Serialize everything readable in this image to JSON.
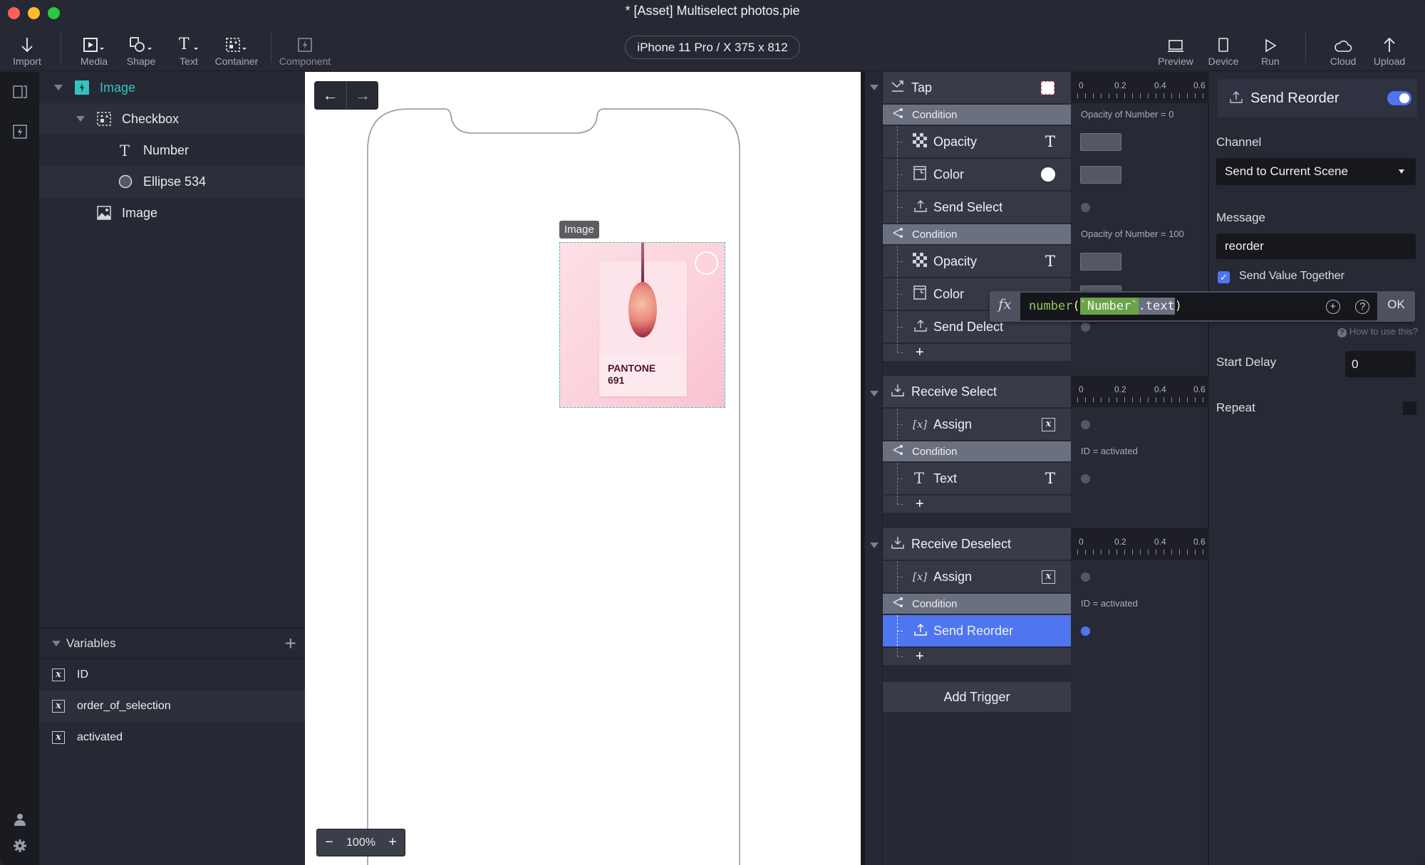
{
  "window": {
    "title": "* [Asset] Multiselect photos.pie"
  },
  "toolbar": {
    "left_tools": [
      {
        "id": "import",
        "label": "Import",
        "icon": "arrow-down-icon"
      },
      {
        "id": "media",
        "label": "Media",
        "icon": "media-icon"
      },
      {
        "id": "shape",
        "label": "Shape",
        "icon": "shape-icon"
      },
      {
        "id": "text",
        "label": "Text",
        "icon": "text-icon"
      },
      {
        "id": "container",
        "label": "Container",
        "icon": "container-icon"
      },
      {
        "id": "component",
        "label": "Component",
        "icon": "component-icon"
      }
    ],
    "device": "iPhone 11 Pro / X  375 x 812",
    "right_tools": [
      {
        "id": "preview",
        "label": "Preview",
        "icon": "laptop-icon"
      },
      {
        "id": "device",
        "label": "Device",
        "icon": "phone-icon"
      },
      {
        "id": "run",
        "label": "Run",
        "icon": "play-icon"
      },
      {
        "id": "cloud",
        "label": "Cloud",
        "icon": "cloud-icon"
      },
      {
        "id": "upload",
        "label": "Upload",
        "icon": "arrow-up-icon"
      }
    ]
  },
  "layers": {
    "items": [
      {
        "name": "Image",
        "type": "component",
        "selected": true
      },
      {
        "name": "Checkbox",
        "type": "container"
      },
      {
        "name": "Number",
        "type": "text"
      },
      {
        "name": "Ellipse 534",
        "type": "ellipse"
      },
      {
        "name": "Image",
        "type": "image"
      }
    ]
  },
  "variables": {
    "title": "Variables",
    "items": [
      "ID",
      "order_of_selection",
      "activated"
    ]
  },
  "canvas": {
    "selection_tag": "Image",
    "image_caption_line1": "PANTONE",
    "image_caption_line2": "691",
    "zoom": "100%",
    "zoom_minus": "−",
    "zoom_plus": "+",
    "back_arrow": "←",
    "forward_arrow": "→"
  },
  "interactions": {
    "ruler_labels": [
      "0",
      "0.2",
      "0.4",
      "0.6"
    ],
    "tap": {
      "trigger": "Tap",
      "condition1": "Condition",
      "condition1_text": "Opacity of Number = 0",
      "r1": "Opacity",
      "r2": "Color",
      "r3": "Send Select",
      "condition2": "Condition",
      "condition2_text": "Opacity of Number = 100",
      "r4": "Opacity",
      "r5": "Color",
      "r6": "Send Delect",
      "add": "+"
    },
    "receive_select": {
      "trigger": "Receive Select",
      "r1": "Assign",
      "condition": "Condition",
      "condition_text": "ID = activated",
      "r2": "Text",
      "add": "+"
    },
    "receive_deselect": {
      "trigger": "Receive Deselect",
      "r1": "Assign",
      "condition": "Condition",
      "condition_text": "ID = activated",
      "r2": "Send Reorder",
      "add": "+"
    },
    "add_trigger": "Add Trigger"
  },
  "formula": {
    "fx_label": "fx",
    "func": "number",
    "open_paren": "(",
    "ref": "`Number`",
    "prop": ".text",
    "close_paren": ")",
    "ok": "OK"
  },
  "properties": {
    "title": "Send Reorder",
    "enabled": true,
    "channel_label": "Channel",
    "channel_value": "Send to Current Scene",
    "message_label": "Message",
    "message_value": "reorder",
    "send_value_label": "Send Value Together",
    "send_value_checked": true,
    "help": "How to use this?",
    "start_delay_label": "Start Delay",
    "start_delay_value": "0",
    "repeat_label": "Repeat",
    "repeat_checked": false
  }
}
